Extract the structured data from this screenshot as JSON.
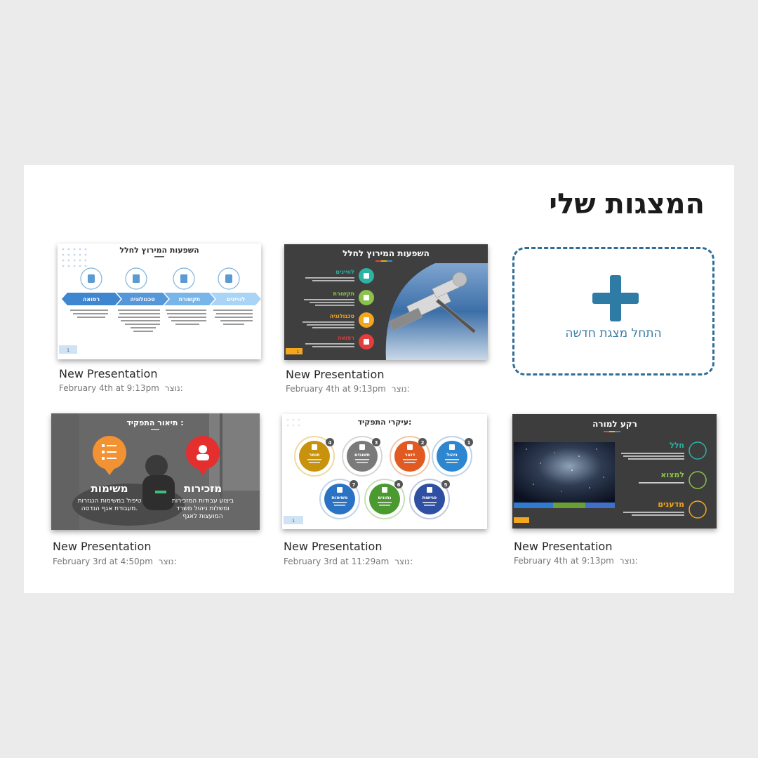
{
  "page": {
    "title": "המצגות שלי"
  },
  "new_presentation": {
    "label": "התחל מצגת חדשה"
  },
  "created_prefix": "נוצר:",
  "cards": [
    {
      "name": "New Presentation",
      "date": "February 4th at 9:13pm",
      "slide": {
        "title": "השפעות המירוץ לחלל",
        "arrows": [
          "לוויינים",
          "תקשורת",
          "טכנולוגיה",
          "רפואה"
        ],
        "page": "1"
      }
    },
    {
      "name": "New Presentation",
      "date": "February 4th at 9:13pm",
      "slide": {
        "title": "השפעות המירוץ לחלל",
        "items": [
          "לוויינים",
          "תקשורת",
          "טכנולוגיה",
          "רפואה"
        ],
        "page": "1"
      }
    },
    {
      "name": "New Presentation",
      "date": "February 3rd at 4:50pm",
      "slide": {
        "title": "תיאור התפקיד :",
        "items": [
          {
            "heading": "מזכירות",
            "text": [
              "ביצוע עבודות המזכירות",
              "ומשלות ניהול משרד",
              "המועצות לאגף"
            ]
          },
          {
            "heading": "משימות",
            "text": [
              "טיפול במשימות הנגזרות",
              "מעבודת אגף הנדסה."
            ]
          }
        ]
      }
    },
    {
      "name": "New Presentation",
      "date": "February 3rd at 11:29am",
      "slide": {
        "title": "עיקרי התפקיד:",
        "circles": [
          {
            "num": "1",
            "label": "ניהול"
          },
          {
            "num": "2",
            "label": "דואר"
          },
          {
            "num": "3",
            "label": "תשובים"
          },
          {
            "num": "4",
            "label": "חומר"
          },
          {
            "num": "5",
            "label": "פגישות"
          },
          {
            "num": "6",
            "label": "נתונים"
          },
          {
            "num": "7",
            "label": "משימות"
          }
        ],
        "page": "1"
      }
    },
    {
      "name": "New Presentation",
      "date": "February 4th at 9:13pm",
      "slide": {
        "title": "רקע למורה",
        "items": [
          "חלל",
          "למצוא",
          "מדענים"
        ]
      }
    }
  ],
  "colors": {
    "accent": "#2e7ca6",
    "dashed_border": "#2e6e96",
    "panel": "#ffffff",
    "background": "#ebebeb"
  }
}
